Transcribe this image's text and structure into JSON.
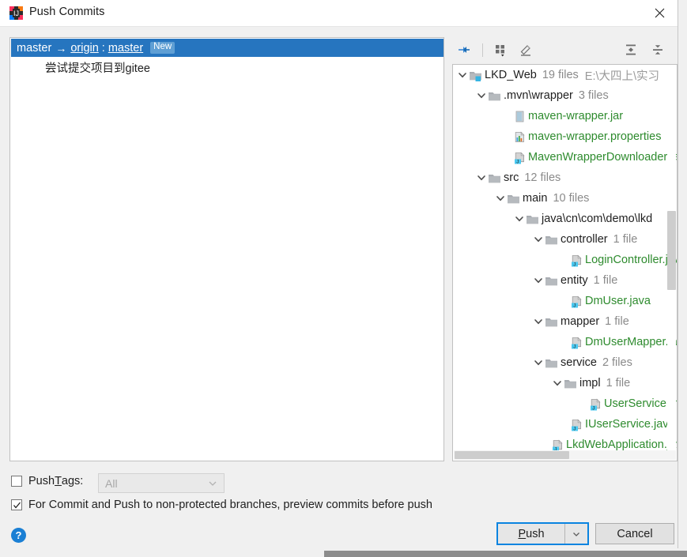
{
  "window": {
    "title": "Push Commits",
    "app_icon": "intellij-idea-icon",
    "close_icon": "close-icon"
  },
  "commits": {
    "header": {
      "local_branch": "master",
      "arrow": "→",
      "remote": "origin",
      "separator": ":",
      "remote_branch": "master",
      "badge": "New"
    },
    "message": "尝试提交项目到gitee"
  },
  "files_toolbar": {
    "buttons": [
      {
        "name": "show-diff-icon",
        "glyph": "diff"
      },
      {
        "name": "group-by-icon",
        "glyph": "group"
      },
      {
        "name": "edit-source-icon",
        "glyph": "pencil"
      },
      {
        "name": "expand-all-icon",
        "glyph": "expand"
      },
      {
        "name": "collapse-all-icon",
        "glyph": "collapse"
      }
    ]
  },
  "file_tree": [
    {
      "label": "LKD_Web",
      "meta": "19 files",
      "path": "E:\\大四上\\实习",
      "kind": "module",
      "indent": 0,
      "expanded": true
    },
    {
      "label": ".mvn\\wrapper",
      "meta": "3 files",
      "kind": "folder",
      "indent": 1,
      "expanded": true
    },
    {
      "label": "maven-wrapper.jar",
      "kind": "jar",
      "indent": 2,
      "new": true
    },
    {
      "label": "maven-wrapper.properties",
      "kind": "properties",
      "indent": 2,
      "new": true
    },
    {
      "label": "MavenWrapperDownloader.java",
      "kind": "java",
      "indent": 2,
      "new": true
    },
    {
      "label": "src",
      "meta": "12 files",
      "kind": "folder",
      "indent": 1,
      "expanded": true
    },
    {
      "label": "main",
      "meta": "10 files",
      "kind": "folder",
      "indent": 2,
      "expanded": true
    },
    {
      "label": "java\\cn\\com\\demo\\lkd",
      "kind": "folder",
      "indent": 3,
      "expanded": true
    },
    {
      "label": "controller",
      "meta": "1 file",
      "kind": "folder",
      "indent": 4,
      "expanded": true
    },
    {
      "label": "LoginController.java",
      "kind": "java",
      "indent": 5,
      "new": true
    },
    {
      "label": "entity",
      "meta": "1 file",
      "kind": "folder",
      "indent": 4,
      "expanded": true
    },
    {
      "label": "DmUser.java",
      "kind": "java",
      "indent": 5,
      "new": true
    },
    {
      "label": "mapper",
      "meta": "1 file",
      "kind": "folder",
      "indent": 4,
      "expanded": true
    },
    {
      "label": "DmUserMapper.java",
      "kind": "java",
      "indent": 5,
      "new": true
    },
    {
      "label": "service",
      "meta": "2 files",
      "kind": "folder",
      "indent": 4,
      "expanded": true
    },
    {
      "label": "impl",
      "meta": "1 file",
      "kind": "folder",
      "indent": 5,
      "expanded": true
    },
    {
      "label": "UserServiceImpl.java",
      "kind": "java",
      "indent": 6,
      "new": true
    },
    {
      "label": "IUserService.java",
      "kind": "java",
      "indent": 5,
      "new": true
    },
    {
      "label": "LkdWebApplication.java",
      "kind": "java",
      "indent": 4,
      "new": true
    }
  ],
  "options": {
    "push_tags": {
      "label_before": "Push ",
      "label_mnemonic": "T",
      "label_after": "ags:",
      "checked": false,
      "combo_value": "All",
      "combo_enabled": false
    },
    "preview": {
      "label": "For Commit and Push to non-protected branches, preview commits before push",
      "checked": true
    }
  },
  "footer": {
    "help_label": "?",
    "push_before": "P",
    "push_after": "ush",
    "push_dropdown_icon": "chevron-down-icon",
    "cancel_label": "Cancel"
  },
  "colors": {
    "selection_blue": "#2675bf",
    "badge_blue": "#5f9fd4",
    "new_file_green": "#2e8b2e",
    "focus_blue": "#0a84e0",
    "help_blue": "#1a7fd4"
  }
}
